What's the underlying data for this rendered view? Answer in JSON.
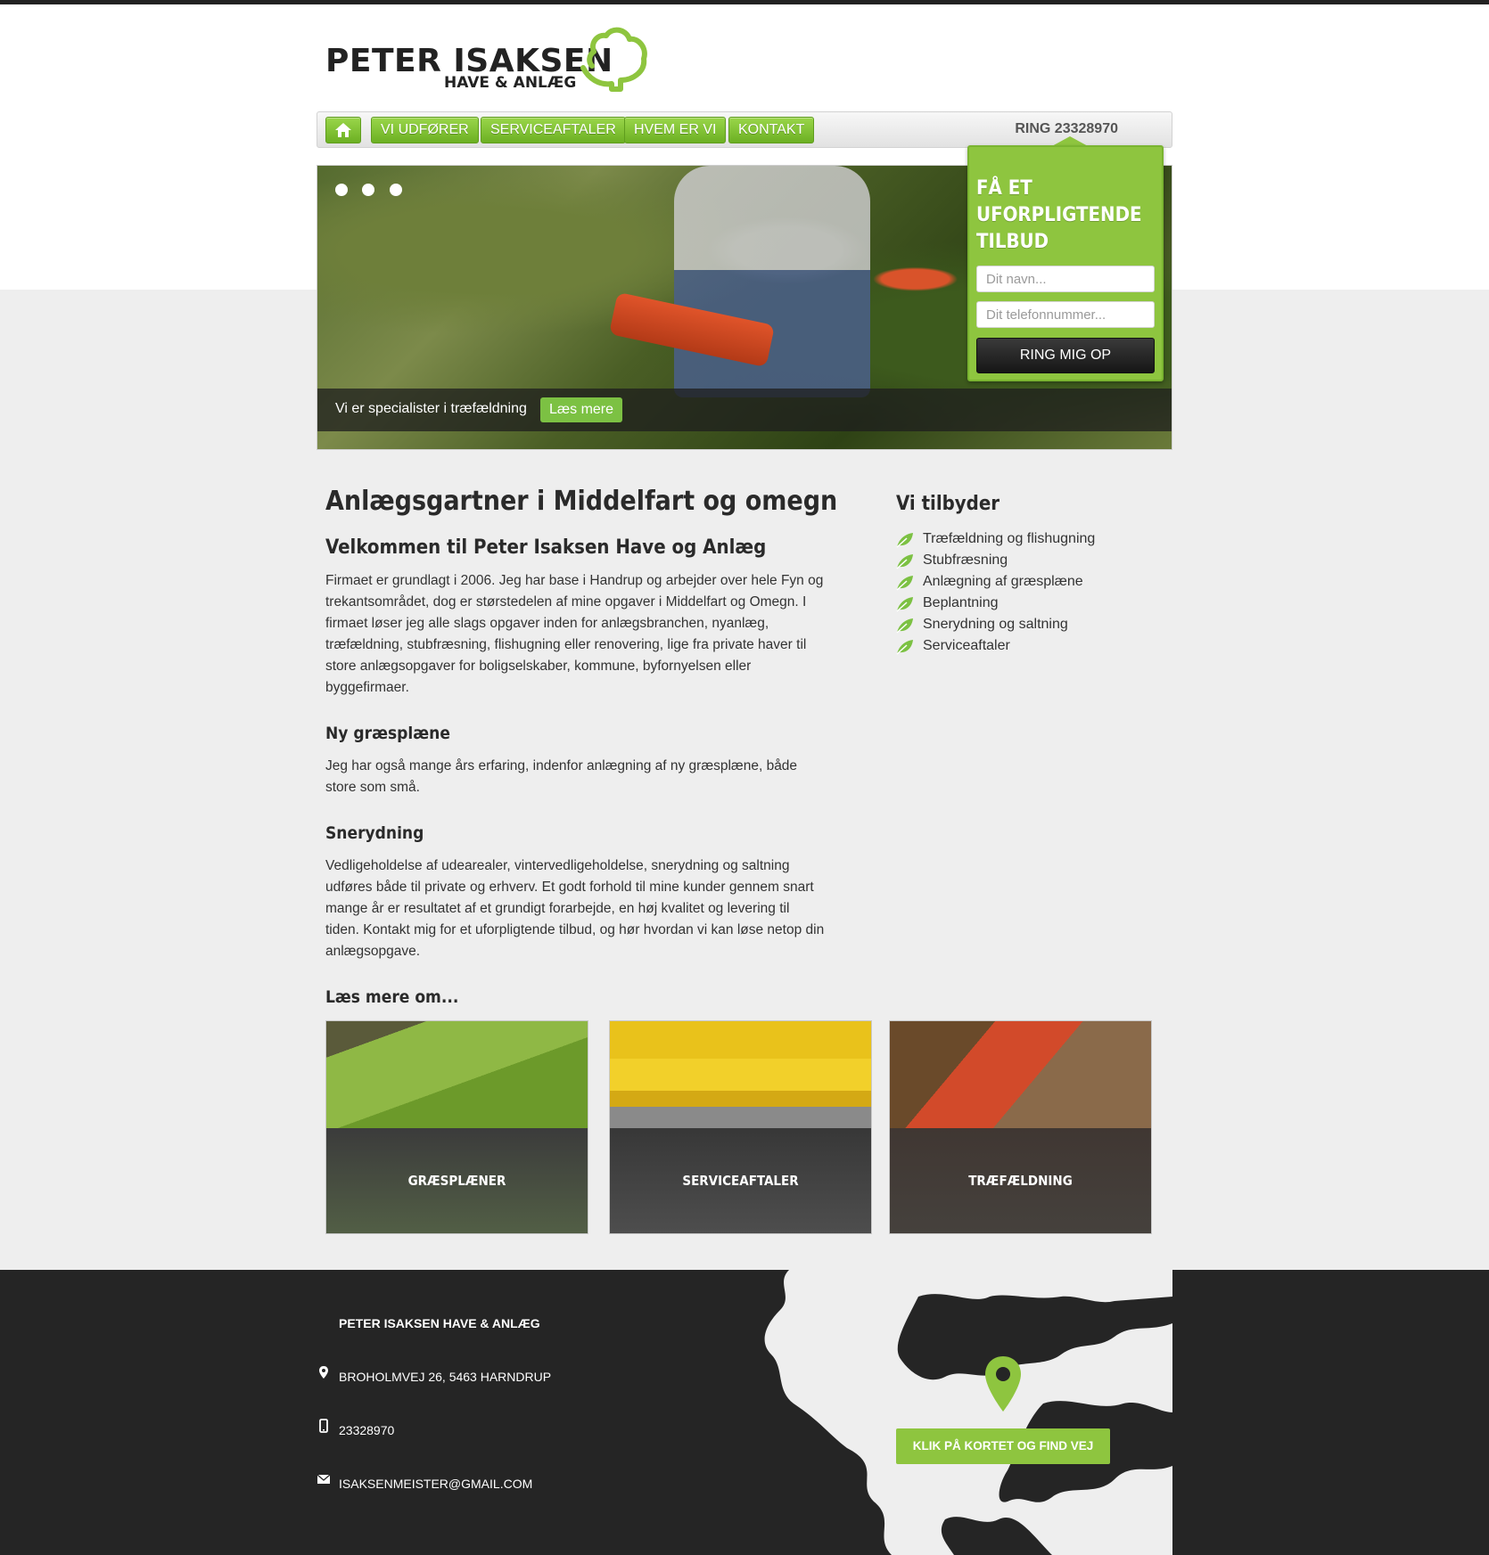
{
  "brand": {
    "name": "PETER ISAKSEN",
    "tagline": "HAVE & ANLÆG"
  },
  "nav": {
    "items": [
      {
        "label": "VI UDFØRER"
      },
      {
        "label": "SERVICEAFTALER"
      },
      {
        "label": "HVEM ER VI"
      },
      {
        "label": "KONTAKT"
      }
    ],
    "phone": "RING 23328970"
  },
  "hero": {
    "caption": "Vi er specialister i træfældning",
    "cta": "Læs mere"
  },
  "offer": {
    "title": "FÅ ET UFORPLIGTENDE TILBUD",
    "name_placeholder": "Dit navn...",
    "phone_placeholder": "Dit telefonnummer...",
    "button": "RING MIG OP"
  },
  "content": {
    "h1": "Anlægsgartner i Middelfart og omegn",
    "h2": "Velkommen til Peter Isaksen Have og Anlæg",
    "intro": "Firmaet er grundlagt i 2006. Jeg har base i Handrup og arbejder over hele Fyn og trekantsområdet, dog er størstedelen af mine opgaver i Middelfart og Omegn. I firmaet løser jeg alle slags opgaver inden for anlægsbranchen, nyanlæg, træfældning, stubfræsning, flishugning eller renovering, lige fra private haver til store anlægsopgaver for boligselskaber, kommune, byfornyelsen eller byggefirmaer.",
    "section1_title": "Ny græsplæne",
    "section1_text": "Jeg har også mange års erfaring, indenfor anlægning af ny græsplæne, både store som små.",
    "section2_title": "Snerydning",
    "section2_text": "Vedligeholdelse af udearealer, vintervedligeholdelse, snerydning og saltning udføres både til private og erhverv. Et godt forhold til mine kunder gennem snart mange år er resultatet af et grundigt forarbejde, en høj kvalitet og levering til tiden. Kontakt mig for et uforpligtende tilbud, og hør hvordan vi kan løse netop din anlægsopgave."
  },
  "sidebar": {
    "title": "Vi tilbyder",
    "items": [
      "Træfældning og flishugning",
      "Stubfræsning",
      "Anlægning af græsplæne",
      "Beplantning",
      "Snerydning og saltning",
      "Serviceaftaler"
    ]
  },
  "more": {
    "title": "Læs mere om...",
    "tiles": [
      {
        "label": "GRÆSPLÆNER"
      },
      {
        "label": "SERVICEAFTALER"
      },
      {
        "label": "TRÆFÆLDNING"
      }
    ]
  },
  "footer": {
    "company": "PETER ISAKSEN HAVE & ANLÆG",
    "address": "BROHOLMVEJ 26, 5463 HARNDRUP",
    "phone": "23328970",
    "email": "ISAKSENMEISTER@GMAIL.COM",
    "map_button": "KLIK PÅ KORTET OG FIND VEJ"
  },
  "colors": {
    "accent": "#8ec53f",
    "dark": "#252525",
    "background": "#eeeeee"
  },
  "icons": [
    "home-icon",
    "leaf-icon",
    "map-pin-icon",
    "phone-icon",
    "mail-icon",
    "location-icon",
    "tree-logo-icon"
  ]
}
